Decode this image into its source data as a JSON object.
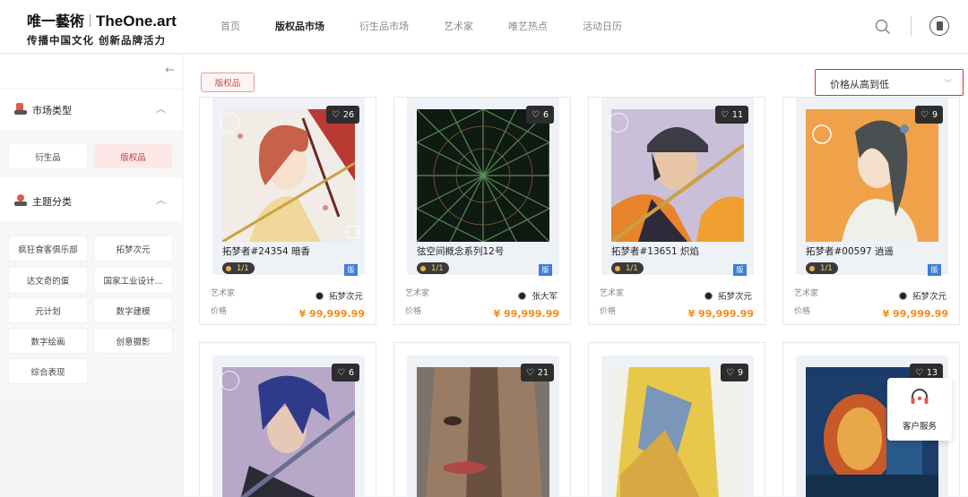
{
  "logo": {
    "cn": "唯一藝術",
    "en": "TheOne.art",
    "slogan": "传播中国文化 创新品牌活力"
  },
  "nav": [
    {
      "label": "首页",
      "active": false
    },
    {
      "label": "版权品市场",
      "active": true
    },
    {
      "label": "衍生品市场",
      "active": false
    },
    {
      "label": "艺术家",
      "active": false
    },
    {
      "label": "唯艺热点",
      "active": false
    },
    {
      "label": "活动日历",
      "active": false
    }
  ],
  "sidebar": {
    "market_type": {
      "title": "市场类型",
      "options": [
        "衍生品",
        "版权品"
      ],
      "selected": "版权品"
    },
    "theme": {
      "title": "主题分类",
      "options": [
        "疯狂食客俱乐部",
        "拓梦次元",
        "达文奇的蛋",
        "国家工业设计...",
        "元计划",
        "数字建模",
        "数字绘画",
        "创意摄影",
        "综合表现"
      ]
    }
  },
  "filter_tag": "版权品",
  "sort": {
    "selected": "价格从高到低"
  },
  "labels": {
    "artist": "艺术家",
    "price": "价格",
    "ban": "版"
  },
  "cards": [
    {
      "title": "拓梦者#24354 暗香",
      "likes": "26",
      "edition": "1/1",
      "artist": "拓梦次元",
      "price": "¥ 99,999.99"
    },
    {
      "title": "弦空间概念系列12号",
      "likes": "6",
      "edition": "1/1",
      "artist": "张大军",
      "price": "¥ 99,999.99"
    },
    {
      "title": "拓梦者#13651 炽焰",
      "likes": "11",
      "edition": "1/1",
      "artist": "拓梦次元",
      "price": "¥ 99,999.99"
    },
    {
      "title": "拓梦者#00597 逍遥",
      "likes": "9",
      "edition": "1/1",
      "artist": "拓梦次元",
      "price": "¥ 99,999.99"
    },
    {
      "likes": "6"
    },
    {
      "likes": "21"
    },
    {
      "likes": "9"
    },
    {
      "likes": "13"
    }
  ],
  "service": {
    "label": "客户服务"
  },
  "colors": {
    "accent": "#c8474a",
    "price": "#f08c1e",
    "badge_blue": "#3e7fd6"
  }
}
